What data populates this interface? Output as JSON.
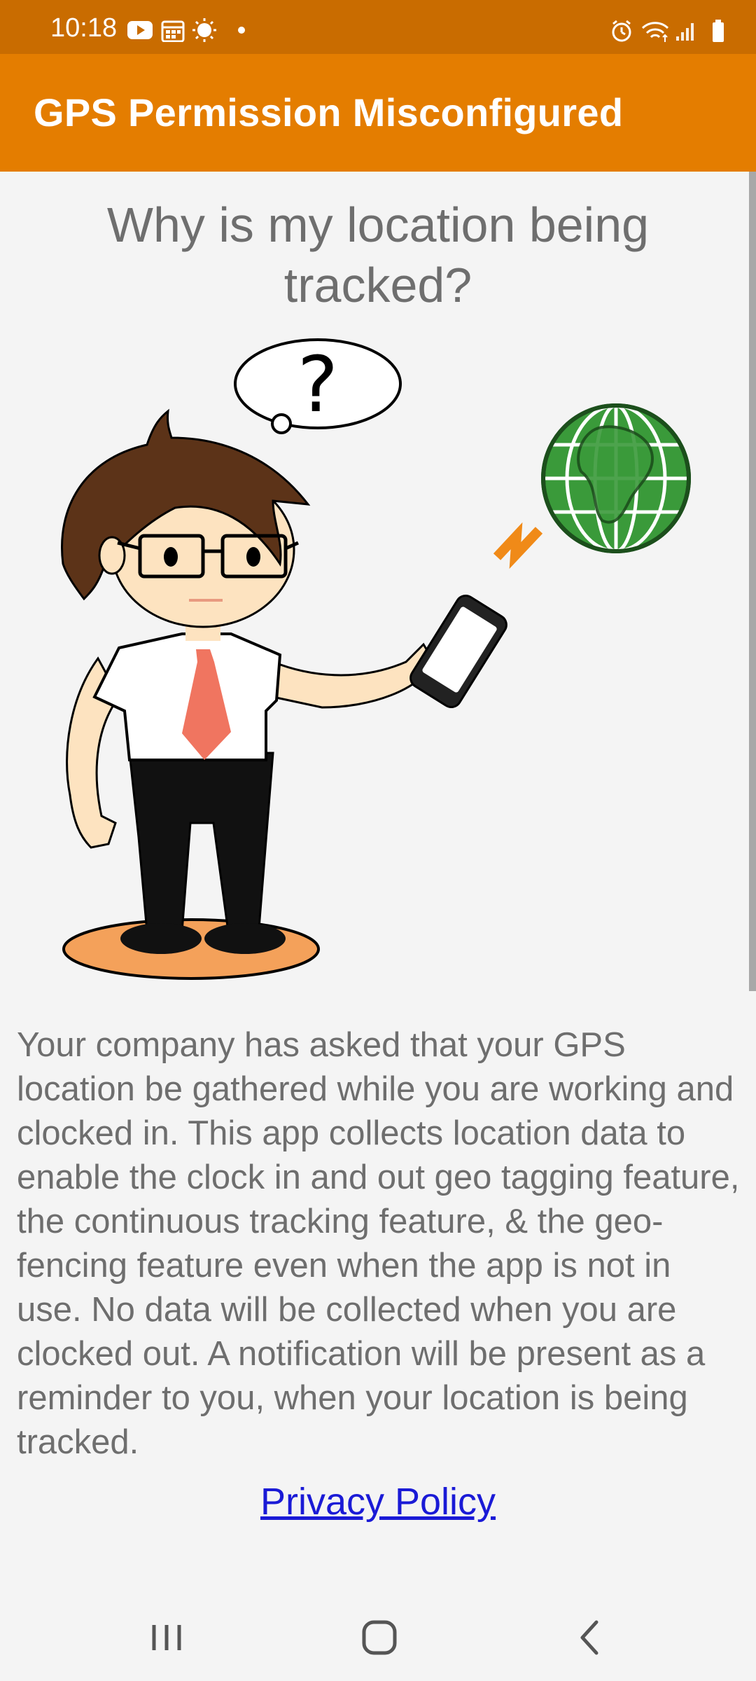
{
  "status_bar": {
    "time": "10:18",
    "left_icons": [
      "youtube-icon",
      "calendar-icon",
      "brightness-icon",
      "dot-icon"
    ],
    "right_icons": [
      "alarm-icon",
      "wifi-icon",
      "signal-icon",
      "battery-icon"
    ]
  },
  "app_bar": {
    "title": "GPS Permission Misconfigured",
    "color": "#e47d00"
  },
  "main": {
    "heading": "Why is my location being tracked?",
    "illustration_icon": "person-with-phone-and-globe-illustration",
    "illustration_question_mark": "?",
    "body": "Your company has asked that your GPS location be gathered while you are working and clocked in.  This app collects location data to enable the clock in and out geo tagging feature, the continuous tracking feature, & the geo-fencing feature even when the app is not in use.  No data will be collected when you are clocked out.  A notification will be present as a reminder to you, when your location is being tracked.",
    "privacy_link": "Privacy Policy"
  },
  "nav_bar": {
    "buttons": [
      "recent-apps-icon",
      "home-icon",
      "back-icon"
    ]
  }
}
